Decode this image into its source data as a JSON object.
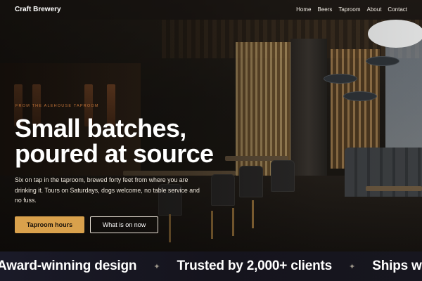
{
  "nav": {
    "brand": "Craft Brewery",
    "links": [
      "Home",
      "Beers",
      "Taproom",
      "About",
      "Contact"
    ]
  },
  "hero": {
    "eyebrow": "FROM THE ALEHOUSE TAPROOM",
    "headline_line1": "Small batches,",
    "headline_line2": "poured at source",
    "lede": "Six on tap in the taproom, brewed forty feet from where you are drinking it. Tours on Saturdays, dogs welcome, no table service and no fuss.",
    "primary_cta": "Taproom hours",
    "secondary_cta": "What is on now"
  },
  "marquee": {
    "items": [
      "Award-winning design",
      "Trusted by 2,000+ clients",
      "Ships wo"
    ],
    "separator": "✦"
  },
  "colors": {
    "accent": "#d9a14c",
    "eyebrow": "#d9823f",
    "marquee_bg": "#17161f"
  }
}
